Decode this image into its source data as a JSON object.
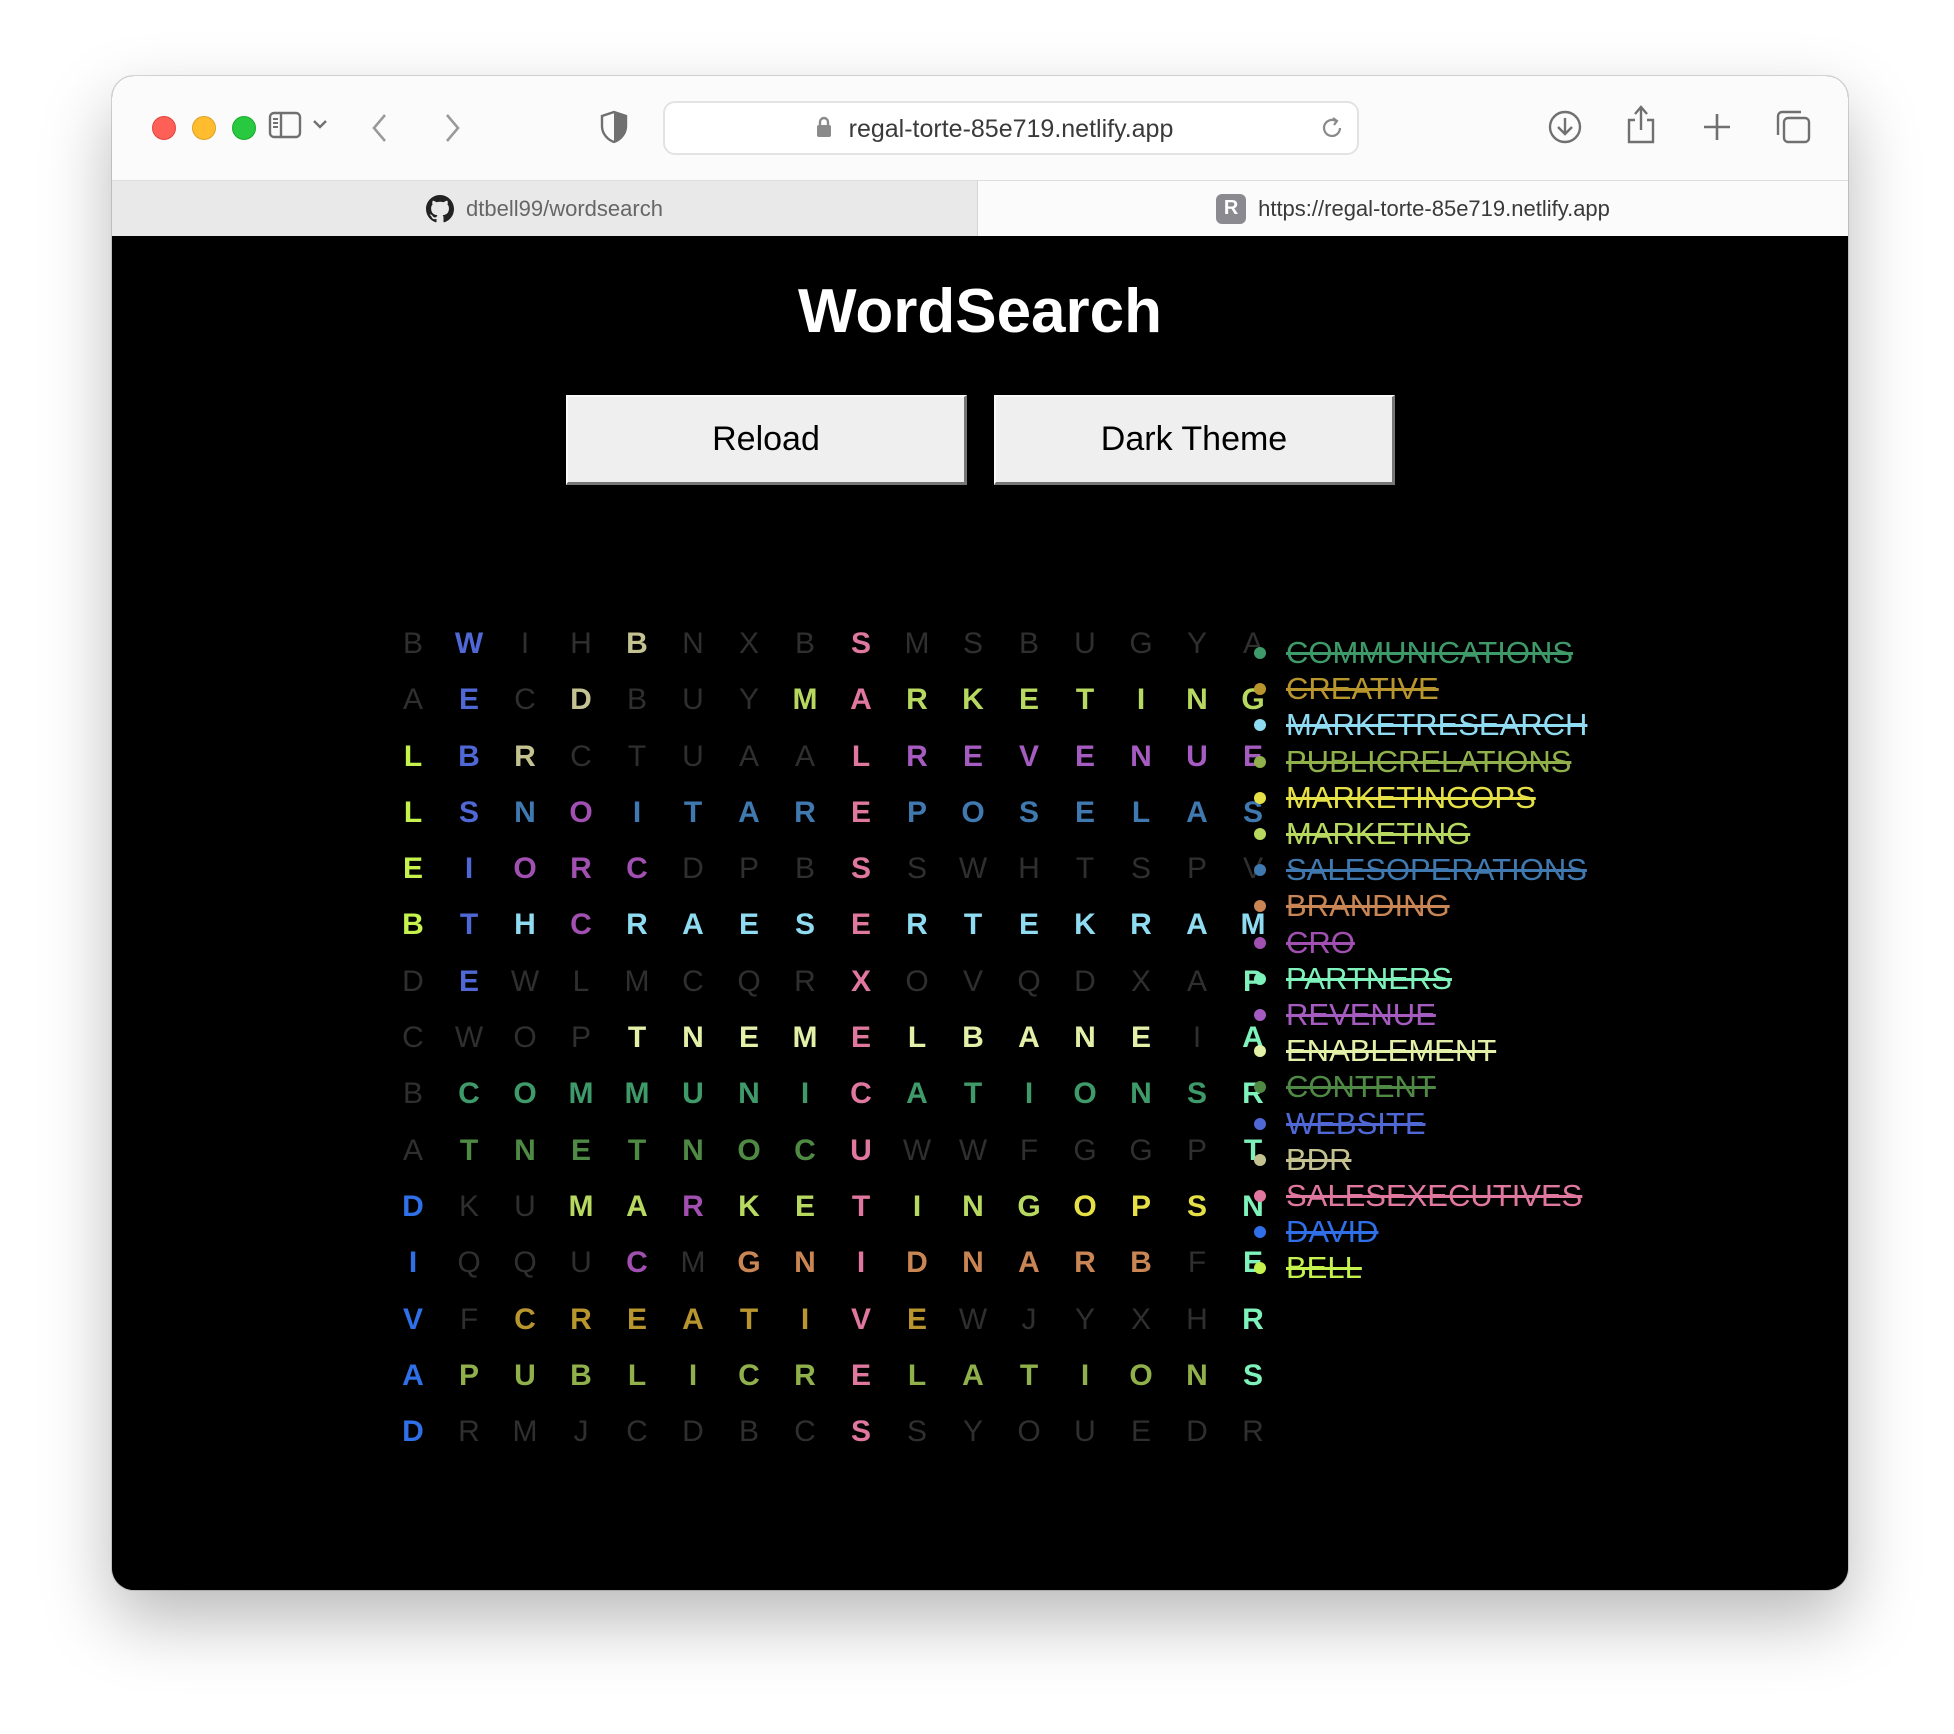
{
  "browser": {
    "url": "regal-torte-85e719.netlify.app",
    "tabs": [
      {
        "label": "dtbell99/wordsearch",
        "icon": "github-icon",
        "active": false
      },
      {
        "label": "https://regal-torte-85e719.netlify.app",
        "icon": "R",
        "active": true
      }
    ]
  },
  "page": {
    "title": "WordSearch",
    "reload_label": "Reload",
    "theme_label": "Dark Theme"
  },
  "grid": {
    "rows": [
      "BWIHBNXBSMSBUGYA",
      "AECDBUYMARKETING",
      "LBRCTUAALREVENUE",
      "LSNOITAREPOSELAS",
      "EIORCDPBSSWHTSPV",
      "BTHCRAESERTEKRAM",
      "DEWLMCQRXOVQDXAP",
      "CWOPTNEMELBANEIA",
      "BCOMMUNICATIONSR",
      "ATNETNOCUWWFGGPT",
      "DKUMARKETINGOPSN",
      "IQQUCMGNIDNARBFE",
      "VFCREATIVEWJYXHR",
      "APUBLICRELATIONS",
      "DRMJCDBCSSYOUEDR"
    ],
    "dim_color": "#2f2f2f"
  },
  "words": [
    {
      "text": "COMMUNICATIONS",
      "color": "#3f9a6a"
    },
    {
      "text": "CREATIVE",
      "color": "#b9952d"
    },
    {
      "text": "MARKETRESEARCH",
      "color": "#8fdcf2"
    },
    {
      "text": "PUBLICRELATIONS",
      "color": "#8fb04a"
    },
    {
      "text": "MARKETINGOPS",
      "color": "#e6e047"
    },
    {
      "text": "MARKETING",
      "color": "#b8d960"
    },
    {
      "text": "SALESOPERATIONS",
      "color": "#3f79b0"
    },
    {
      "text": "BRANDING",
      "color": "#c98554"
    },
    {
      "text": "CRO",
      "color": "#a14fb0"
    },
    {
      "text": "PARTNERS",
      "color": "#7ef2ba"
    },
    {
      "text": "REVENUE",
      "color": "#a55bc0"
    },
    {
      "text": "ENABLEMENT",
      "color": "#e3f0a8"
    },
    {
      "text": "CONTENT",
      "color": "#4f8a45"
    },
    {
      "text": "WEBSITE",
      "color": "#4f68d6"
    },
    {
      "text": "BDR",
      "color": "#c4c291"
    },
    {
      "text": "SALESEXECUTIVES",
      "color": "#e0779f"
    },
    {
      "text": "DAVID",
      "color": "#2f6fe8"
    },
    {
      "text": "BELL",
      "color": "#c6f24e"
    }
  ]
}
